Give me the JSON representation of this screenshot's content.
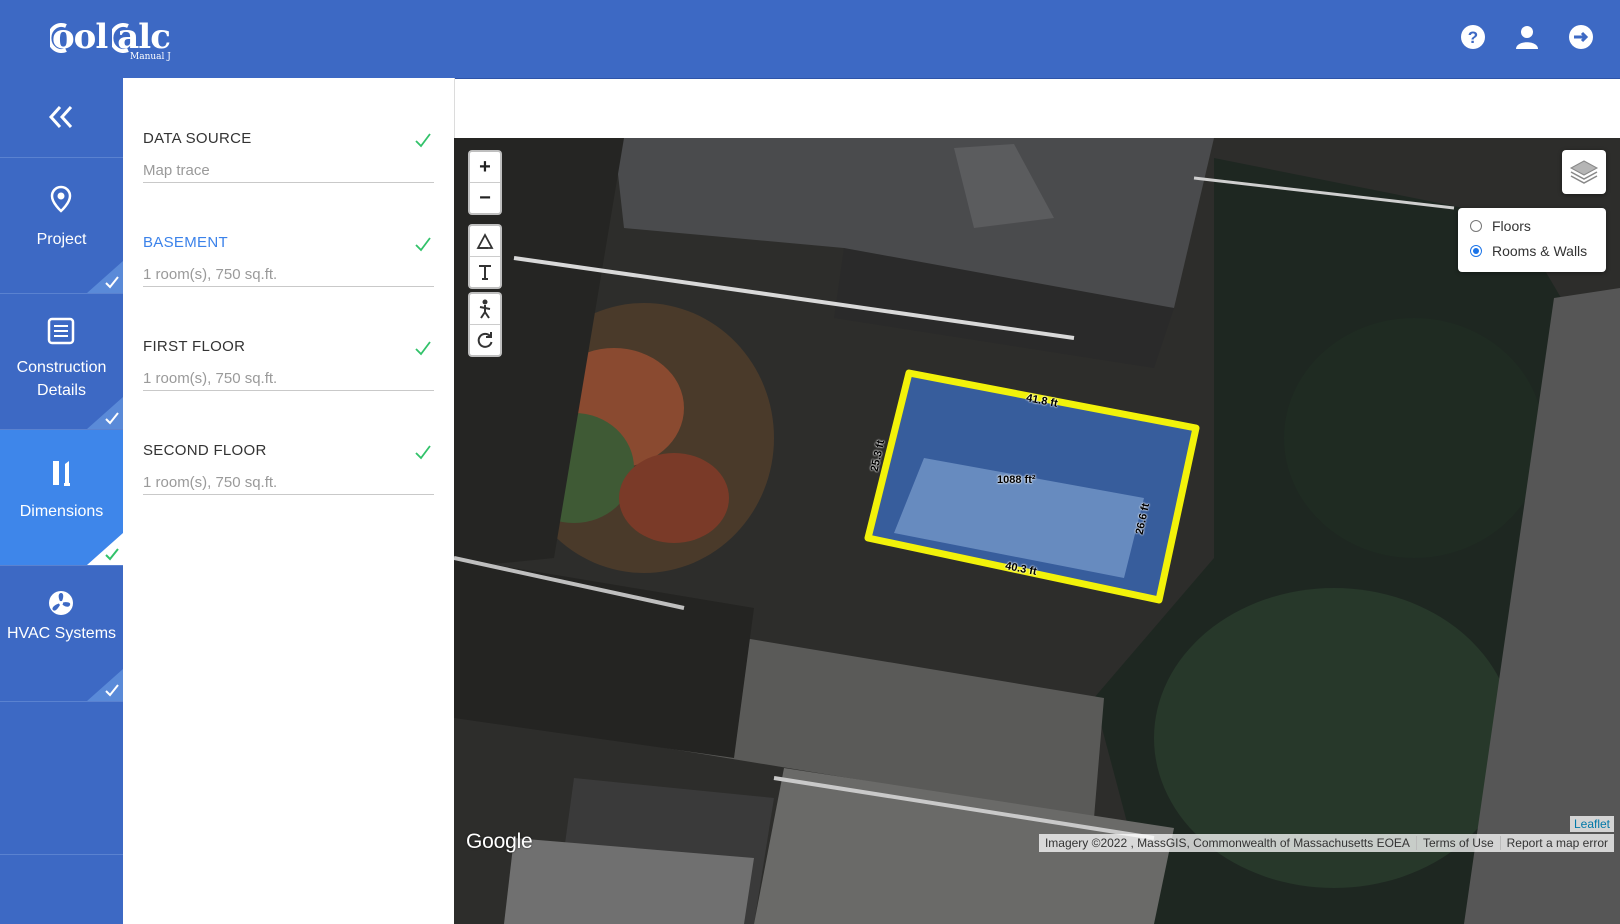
{
  "header": {
    "logo_text": "Cool Calc",
    "logo_sub": "Manual J",
    "icons": [
      "help-icon",
      "user-icon",
      "logout-icon"
    ]
  },
  "nav": {
    "collapse_icon": "double-chevron-left-icon",
    "items": [
      {
        "label": "Project",
        "icon": "location-pin-icon",
        "checked": true,
        "active": false
      },
      {
        "label": "Construction Details",
        "icon": "list-icon",
        "checked": true,
        "active": false
      },
      {
        "label": "Dimensions",
        "icon": "ruler-icon",
        "checked": true,
        "active": true
      },
      {
        "label": "HVAC Systems",
        "icon": "fan-icon",
        "checked": true,
        "active": false
      }
    ]
  },
  "panel": {
    "sections": [
      {
        "title": "DATA SOURCE",
        "sub": "Map trace",
        "checked": true,
        "highlight": false
      },
      {
        "title": "BASEMENT",
        "sub": "1 room(s), 750 sq.ft.",
        "checked": true,
        "highlight": true
      },
      {
        "title": "FIRST FLOOR",
        "sub": "1 room(s), 750 sq.ft.",
        "checked": true,
        "highlight": false
      },
      {
        "title": "SECOND FLOOR",
        "sub": "1 room(s), 750 sq.ft.",
        "checked": true,
        "highlight": false
      }
    ]
  },
  "map": {
    "zoom_in": "+",
    "zoom_out": "−",
    "tools": [
      "draw-polygon-icon",
      "text-tool-icon",
      "pegman-icon",
      "rotate-icon"
    ],
    "layers": {
      "options": [
        "Floors",
        "Rooms & Walls"
      ],
      "selected": "Rooms & Walls"
    },
    "polygon": {
      "area": "1088 ft²",
      "edges": [
        "41.8 ft",
        "26.6 ft",
        "40.3 ft",
        "25.3 ft"
      ],
      "outline_color": "#f2f20a",
      "fill_color": "#3a66b0"
    },
    "provider": "Google",
    "leaflet": "Leaflet",
    "attribution": [
      "Imagery ©2022 , MassGIS, Commonwealth of Massachusetts EOEA",
      "Terms of Use",
      "Report a map error"
    ]
  },
  "colors": {
    "brand": "#3d69c4",
    "active_nav": "#3e86ea",
    "check": "#32c26a",
    "highlight": "#3b82ea"
  }
}
